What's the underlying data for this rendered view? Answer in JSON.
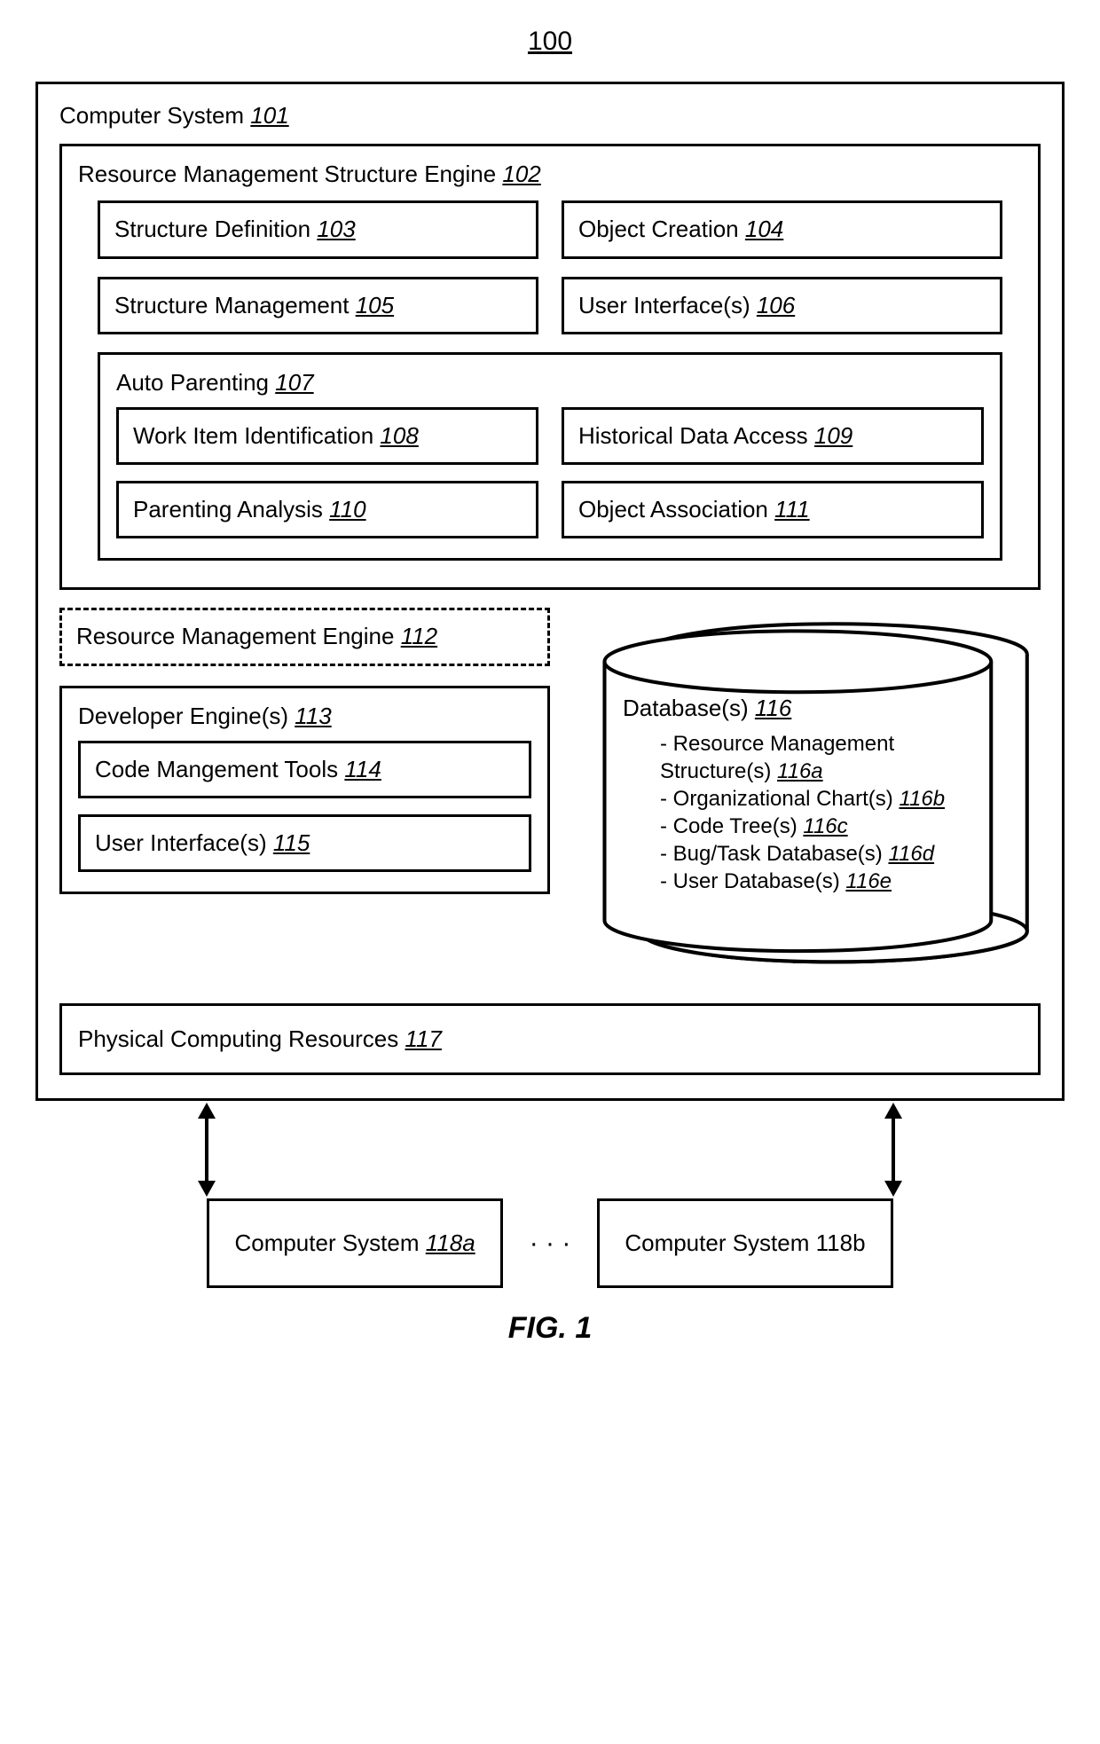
{
  "figure_number": "100",
  "figure_caption": "FIG. 1",
  "outer": {
    "label": "Computer System",
    "ref": "101"
  },
  "engine": {
    "label": "Resource Management Structure Engine",
    "ref": "102"
  },
  "b103": {
    "label": "Structure Definition",
    "ref": "103"
  },
  "b104": {
    "label": "Object Creation",
    "ref": "104"
  },
  "b105": {
    "label": "Structure Management",
    "ref": "105"
  },
  "b106": {
    "label": "User Interface(s)",
    "ref": "106"
  },
  "autoparent": {
    "label": "Auto Parenting",
    "ref": "107"
  },
  "b108": {
    "label": "Work Item Identification",
    "ref": "108"
  },
  "b109": {
    "label": "Historical Data Access",
    "ref": "109"
  },
  "b110": {
    "label": "Parenting Analysis",
    "ref": "110"
  },
  "b111": {
    "label": "Object Association",
    "ref": "111"
  },
  "rme": {
    "label": "Resource Management Engine",
    "ref": "112"
  },
  "dev": {
    "label": "Developer Engine(s)",
    "ref": "113"
  },
  "b114": {
    "label": "Code Mangement Tools",
    "ref": "114"
  },
  "b115": {
    "label": "User Interface(s)",
    "ref": "115"
  },
  "db": {
    "label": "Database(s)",
    "ref": "116"
  },
  "db_items": [
    {
      "t": "- Resource Management",
      "r": ""
    },
    {
      "t": "  Structure(s)",
      "r": "116a"
    },
    {
      "t": "- Organizational Chart(s)",
      "r": "116b"
    },
    {
      "t": "- Code Tree(s)",
      "r": "116c"
    },
    {
      "t": "- Bug/Task Database(s)",
      "r": "116d"
    },
    {
      "t": "- User Database(s)",
      "r": "116e"
    }
  ],
  "db_ell": ". . .",
  "phys": {
    "label": "Physical Computing Resources",
    "ref": "117"
  },
  "cs_a": {
    "label": "Computer System",
    "ref": "118a"
  },
  "cs_b_full": "Computer System 118b",
  "dots": "· · ·"
}
